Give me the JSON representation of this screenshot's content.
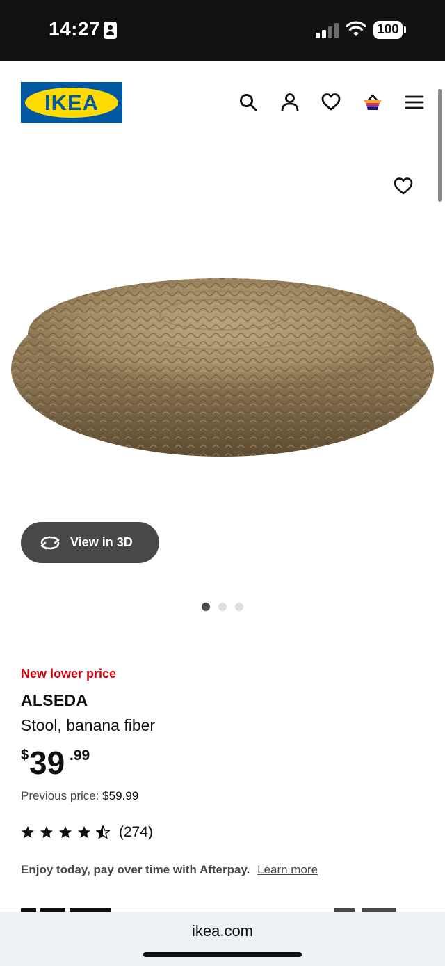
{
  "status_bar": {
    "time": "14:27",
    "battery": "100"
  },
  "header": {
    "logo_text": "IKEA",
    "icons": [
      "search-icon",
      "account-icon",
      "heart-icon",
      "cart-icon",
      "menu-icon"
    ],
    "brand_colors": {
      "blue": "#0058a3",
      "yellow": "#ffdb00"
    }
  },
  "gallery": {
    "view_3d_label": "View in 3D",
    "slides_count": 3,
    "active_slide": 1
  },
  "product": {
    "promo_label": "New lower price",
    "name": "ALSEDA",
    "description": "Stool, banana fiber",
    "price": {
      "currency": "$",
      "integer": "39",
      "decimal": ".99"
    },
    "previous_price_label": "Previous price:",
    "previous_price_value": "$59.99",
    "rating": {
      "stars": 4.5,
      "max": 5,
      "count": "(274)"
    },
    "afterpay_text": "Enjoy today, pay over time with Afterpay.",
    "afterpay_link": "Learn more"
  },
  "browser": {
    "url": "ikea.com"
  },
  "colors": {
    "promo_red": "#cc0008",
    "button_dark": "#484848"
  }
}
